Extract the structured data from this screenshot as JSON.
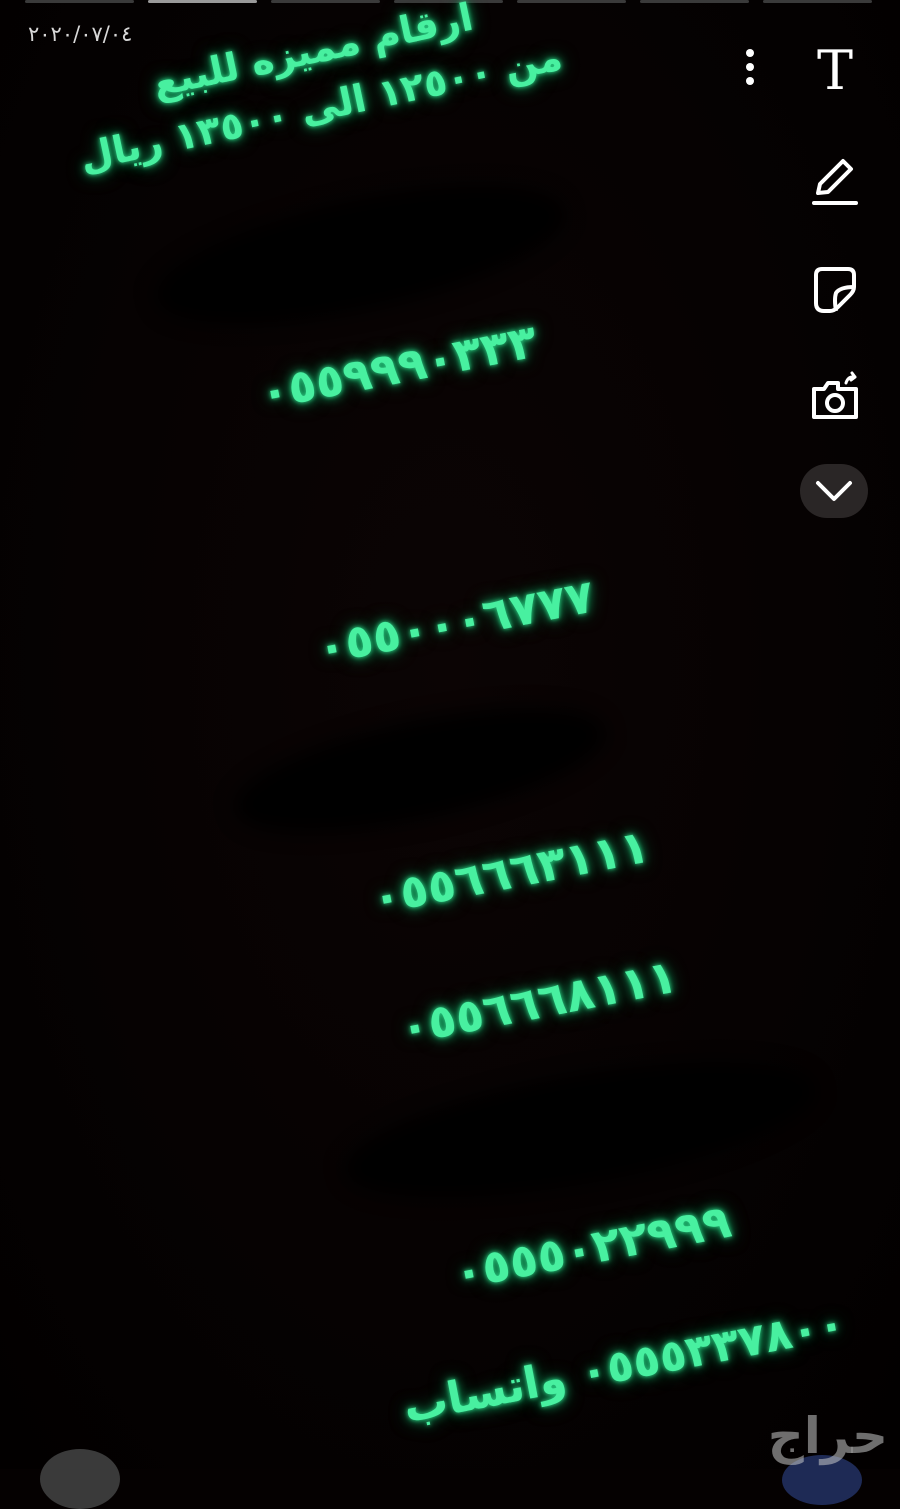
{
  "story": {
    "date": "٢٠٢٠/٠٧/٠٤",
    "progress_segments": 7,
    "active_segment": 2
  },
  "title": {
    "line1": "ارقام مميزه للبيع",
    "line2": "من ١٢٥٠٠ الى ١٣٥٠٠ ريال"
  },
  "numbers": [
    "٠٥٥٩٩٩٠٣٣٣",
    "٠٥٥٠٠٠٦٧٧٧",
    "٠٥٥٦٦٦٣١١١",
    "٠٥٥٦٦٦٨١١١",
    "٠٥٥٥٠٢٢٩٩٩"
  ],
  "whatsapp": {
    "number": "٠٥٥٥٣٣٧٨٠٠",
    "label": "واتساب"
  },
  "toolbar": {
    "text_tool": "T",
    "icons": [
      "more-icon",
      "text-icon",
      "pen-icon",
      "sticker-icon",
      "camera-icon",
      "chevron-down-icon"
    ]
  },
  "watermark": "حراج",
  "colors": {
    "neon_green": "#48f0a0",
    "background": "#050101"
  }
}
